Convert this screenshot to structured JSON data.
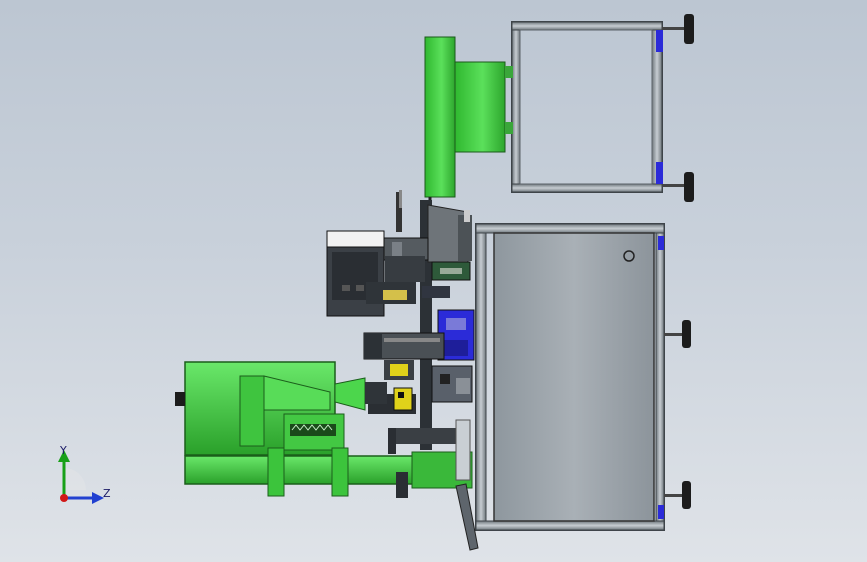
{
  "scene": {
    "type": "cad-assembly-view",
    "colors": {
      "background_top": "#bcc6d2",
      "background_bottom": "#dfe3e8",
      "green": "#44d244",
      "green_dark": "#1f8a1f",
      "frame_gray": "#9ea6ad",
      "frame_dark": "#4b5257",
      "blue": "#2b2bd8",
      "yellow": "#e0d21a"
    }
  },
  "triad": {
    "y_label": "Y",
    "z_label": "Z",
    "y_color": "#18a018",
    "z_color": "#2040d0",
    "x_color": "#d01818"
  }
}
